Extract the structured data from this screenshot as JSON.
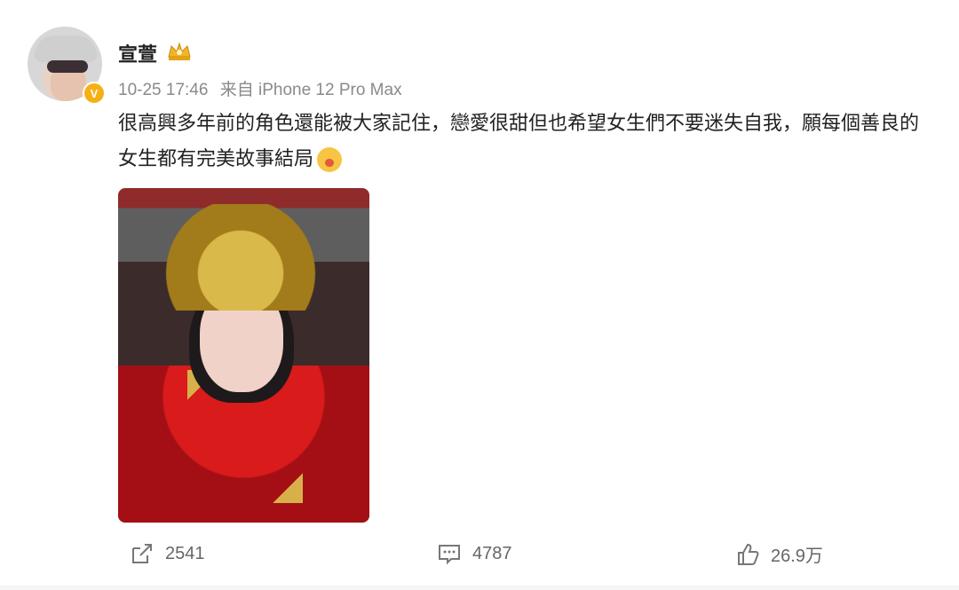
{
  "post": {
    "username": "宣萱",
    "timestamp": "10-25 17:46",
    "source": "来自 iPhone 12 Pro Max",
    "content": "很高興多年前的角色還能被大家記住，戀愛很甜但也希望女生們不要迷失自我，願每個善良的女生都有完美故事結局"
  },
  "actions": {
    "share_count": "2541",
    "comment_count": "4787",
    "like_count": "26.9万"
  },
  "colors": {
    "badge": "#f5b014",
    "text": "#222222",
    "meta": "#8a8a8a"
  }
}
